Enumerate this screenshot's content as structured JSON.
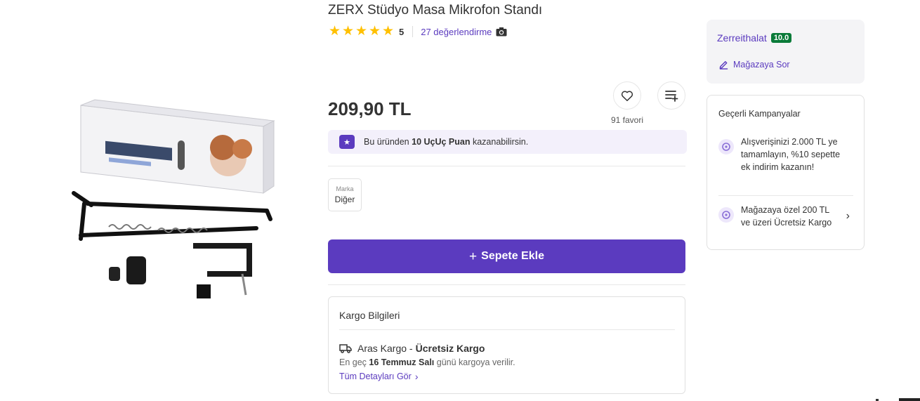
{
  "product": {
    "title": "ZERX Stüdyo Masa Mikrofon Standı",
    "rating_value": "5",
    "stars": [
      "★",
      "★",
      "★",
      "★",
      "★"
    ],
    "review_link": "27 değerlendirme",
    "favorite_count": "91 favori",
    "price": "209,90 TL"
  },
  "points": {
    "prefix": "Bu üründen",
    "amount": "10 UçUç Puan",
    "suffix": "kazanabilirsin."
  },
  "brand": {
    "label": "Marka",
    "value": "Diğer"
  },
  "cart": {
    "plus": "+",
    "label": "Sepete Ekle"
  },
  "cargo": {
    "title": "Kargo Bilgileri",
    "carrier": "Aras Kargo -",
    "shipping_type": "Ücretsiz Kargo",
    "eta_prefix": "En geç",
    "eta_date": "16 Temmuz Salı",
    "eta_suffix": "günü kargoya verilir.",
    "details_link": "Tüm Detayları Gör",
    "chevron": "›"
  },
  "store": {
    "name": "Zerreithalat",
    "score": "10.0",
    "ask_label": "Mağazaya Sor"
  },
  "campaigns": {
    "title": "Geçerli Kampanyalar",
    "items": [
      {
        "text": "Alışverişinizi 2.000 TL ye tamamlayın, %10 sepette ek indirim kazanın!"
      },
      {
        "text": "Mağazaya özel 200 TL ve üzeri Ücretsiz Kargo"
      }
    ],
    "chevron": "›"
  },
  "colors": {
    "accent": "#5b3bbf",
    "star": "#ffc000",
    "store_score_bg": "#0a7b39",
    "points_bg": "#f3f0fb"
  },
  "icons": [
    "camera-icon",
    "heart-icon",
    "add-to-list-icon",
    "star-badge-icon",
    "truck-icon",
    "pen-icon",
    "campaign-icon",
    "chevron-right-icon"
  ]
}
